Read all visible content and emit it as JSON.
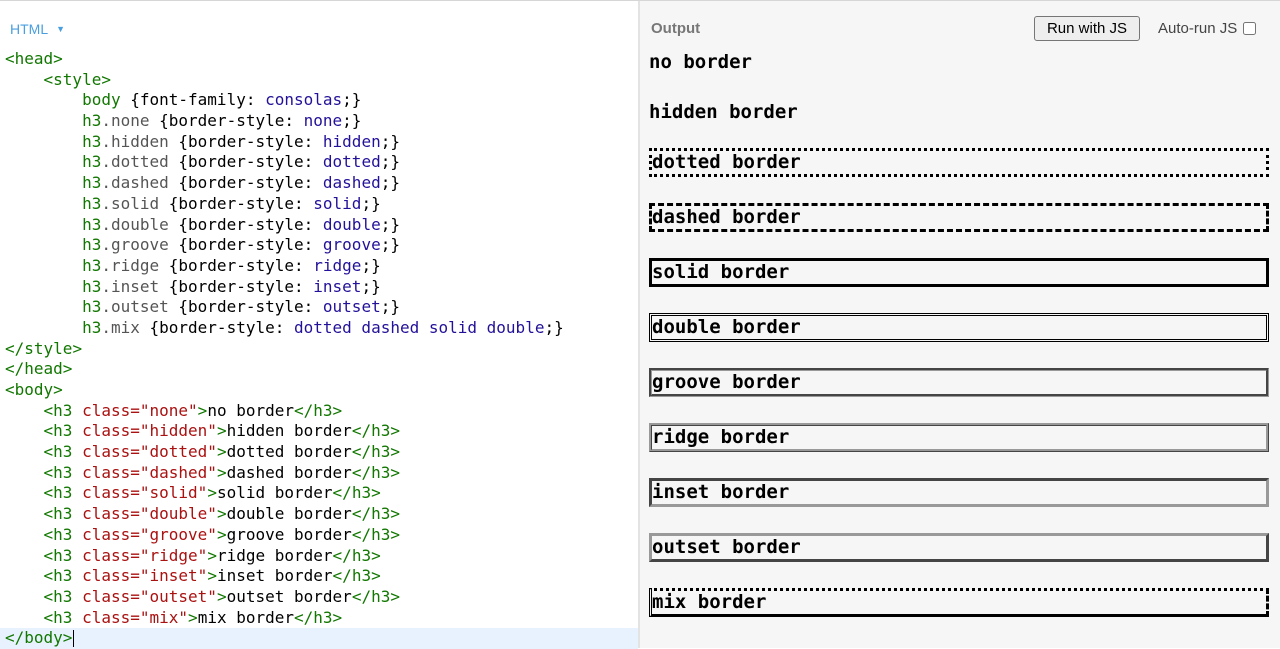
{
  "editor": {
    "language": "HTML",
    "code_lines": [
      "<head>",
      "    <style>",
      "        body {font-family: consolas;}",
      "        h3.none {border-style: none;}",
      "        h3.hidden {border-style: hidden;}",
      "        h3.dotted {border-style: dotted;}",
      "        h3.dashed {border-style: dashed;}",
      "        h3.solid {border-style: solid;}",
      "        h3.double {border-style: double;}",
      "        h3.groove {border-style: groove;}",
      "        h3.ridge {border-style: ridge;}",
      "        h3.inset {border-style: inset;}",
      "        h3.outset {border-style: outset;}",
      "        h3.mix {border-style: dotted dashed solid double;}",
      "</style>",
      "</head>",
      "<body>",
      "    <h3 class=\"none\">no border</h3>",
      "    <h3 class=\"hidden\">hidden border</h3>",
      "    <h3 class=\"dotted\">dotted border</h3>",
      "    <h3 class=\"dashed\">dashed border</h3>",
      "    <h3 class=\"solid\">solid border</h3>",
      "    <h3 class=\"double\">double border</h3>",
      "    <h3 class=\"groove\">groove border</h3>",
      "    <h3 class=\"ridge\">ridge border</h3>",
      "    <h3 class=\"inset\">inset border</h3>",
      "    <h3 class=\"outset\">outset border</h3>",
      "    <h3 class=\"mix\">mix border</h3>",
      "</body>"
    ]
  },
  "output": {
    "title": "Output",
    "run_button": "Run with JS",
    "autorun_label": "Auto-run JS",
    "autorun_checked": false,
    "headings": [
      {
        "style": "none",
        "text": "no border"
      },
      {
        "style": "hidden",
        "text": "hidden border"
      },
      {
        "style": "dotted",
        "text": "dotted border"
      },
      {
        "style": "dashed",
        "text": "dashed border"
      },
      {
        "style": "solid",
        "text": "solid border"
      },
      {
        "style": "double",
        "text": "double border"
      },
      {
        "style": "groove",
        "text": "groove border"
      },
      {
        "style": "ridge",
        "text": "ridge border"
      },
      {
        "style": "inset",
        "text": "inset border"
      },
      {
        "style": "outset",
        "text": "outset border"
      },
      {
        "style": "mix",
        "text": "mix border"
      }
    ]
  },
  "colors": {
    "tag": "#117700",
    "attribute": "#0000cc",
    "string": "#aa1111",
    "css_value": "#221199",
    "language_label": "#4a9fe0",
    "active_line": "#e8f2ff"
  }
}
